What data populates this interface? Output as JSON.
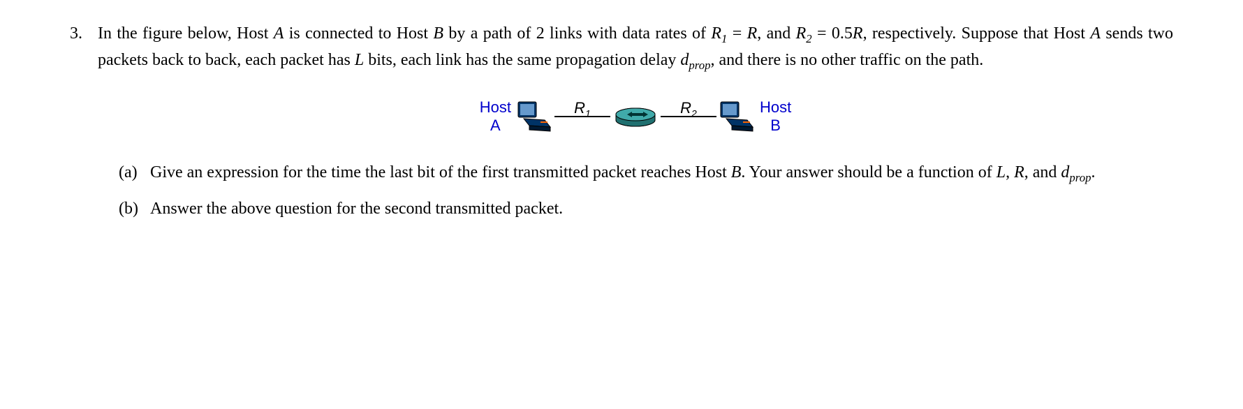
{
  "question": {
    "number": "3.",
    "text_parts": {
      "p1": "In the figure below, Host ",
      "p2": " is connected to Host ",
      "p3": " by a path of 2 links with data rates of ",
      "p4": ", and ",
      "p5": ", respectively. ",
      "p6": "Suppose that Host ",
      "p7": " sends two packets back to back, each packet has ",
      "p8": " bits, each link has the same propagation delay ",
      "p9": ", and there is no other traffic on the path."
    },
    "vars": {
      "A": "A",
      "B": "B",
      "R1": "R",
      "R1sub": "1",
      "eq1": " = ",
      "R": "R",
      "R2": "R",
      "R2sub": "2",
      "eq2": " = 0.5",
      "R2val": "R",
      "L": "L",
      "d": "d",
      "prop": "prop"
    }
  },
  "figure": {
    "hostA_line1": "Host",
    "hostA_line2": "A",
    "hostB_line1": "Host",
    "hostB_line2": "B",
    "R1_label": "R",
    "R1_sub": "1",
    "R2_label": "R",
    "R2_sub": "2"
  },
  "subparts": {
    "a": {
      "label": "(a)",
      "t1": "Give an expression for the time the last bit of the first transmitted packet reaches Host ",
      "t2": ". Your answer should be a function of ",
      "t3": ", ",
      "t4": ", and ",
      "t5": "."
    },
    "b": {
      "label": "(b)",
      "text": "Answer the above question for the second transmitted packet."
    }
  }
}
